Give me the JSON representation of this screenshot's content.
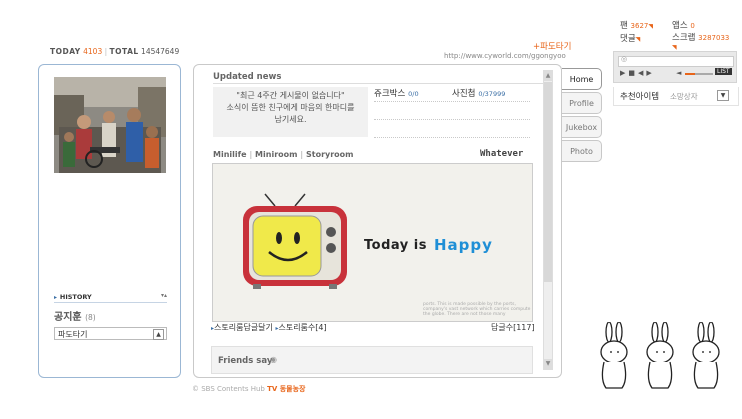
{
  "counter": {
    "today_label": "TODAY",
    "today_value": "4103",
    "sep": "|",
    "total_label": "TOTAL",
    "total_value": "14547649"
  },
  "header": {
    "pado_label": "파도타기",
    "url": "http://www.cyworld.com/ggongyoo"
  },
  "stats": {
    "fan_label": "팬",
    "fan_value": "3627",
    "comment_label": "댓글",
    "apps_label": "앱스",
    "apps_value": "0",
    "scrap_label": "스크랩",
    "scrap_value": "3287033"
  },
  "player": {
    "volume_badge": "LIST"
  },
  "recommend": {
    "label": "추천아이템",
    "dropdown": "소망상자"
  },
  "left": {
    "history_label": "HISTORY",
    "notice_title": "공지훈",
    "notice_count": "(8)",
    "pado_select": "파도타기"
  },
  "center": {
    "updated_news": "Updated news",
    "news_empty_line1": "\"최근 4주간 게시물이 없습니다\"",
    "news_empty_line2": "소식이 뜸한 친구에게 마음의 한마디를",
    "news_empty_line3": "남기세요.",
    "jukebox_label": "쥬크박스",
    "jukebox_value": "0/0",
    "album_label": "사진첩",
    "album_value": "0/37999",
    "nav_minilife": "Minilife",
    "nav_miniroom": "Miniroom",
    "nav_storyroom": "Storyroom",
    "nav_sep": "|",
    "whatever": "Whatever",
    "banner_today": "Today is",
    "banner_happy": "Happy",
    "fine_print_1": "ports. This is made possible by the ports,",
    "fine_print_2": "company's vast network which carries compute",
    "fine_print_3": "the globe. There are not those many",
    "story_link1": "스토리룸답글달기",
    "story_link2": "스토리룸수",
    "story_count": "[4]",
    "reply_label": "답글수",
    "reply_count": "[117]",
    "friends_say": "Friends say"
  },
  "tabs": [
    "Home",
    "Profile",
    "Jukebox",
    "Photo"
  ],
  "footer": {
    "copyright": "© SBS Contents Hub",
    "brand": "TV 동물농장"
  },
  "colors": {
    "accent": "#e8651a",
    "panel_border": "#9bb7d4",
    "happy_blue": "#1f8fd6"
  }
}
